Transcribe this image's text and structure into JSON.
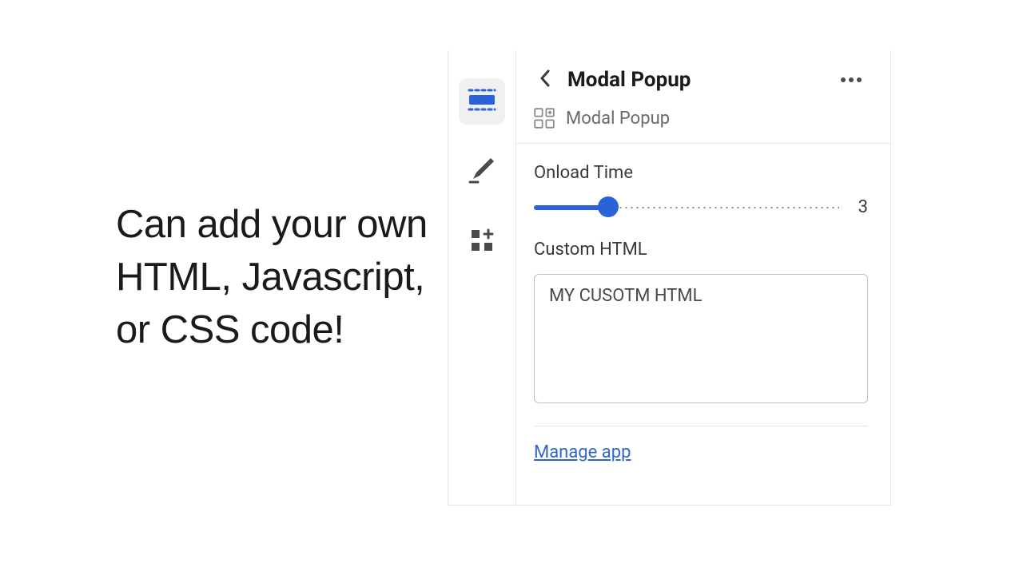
{
  "caption": {
    "line1": "Can add your own",
    "line2": "HTML, Javascript,",
    "line3": "or CSS code!"
  },
  "panel": {
    "title": "Modal Popup",
    "subtitle": "Modal Popup",
    "onload_label": "Onload Time",
    "onload_value": "3",
    "custom_html_label": "Custom HTML",
    "custom_html_value": "MY CUSOTM HTML",
    "manage_link": "Manage app"
  }
}
